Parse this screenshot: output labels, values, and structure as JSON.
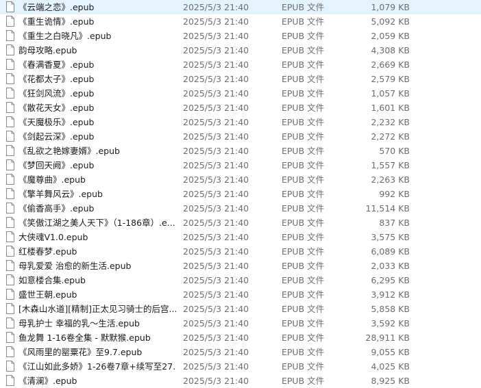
{
  "files": [
    {
      "name": "《云端之恋》.epub",
      "date": "2025/5/3 21:40",
      "type": "EPUB 文件",
      "size": "1,079 KB",
      "icon": "file-icon"
    },
    {
      "name": "《重生诡情》.epub",
      "date": "2025/5/3 21:40",
      "type": "EPUB 文件",
      "size": "5,092 KB",
      "icon": "file-icon"
    },
    {
      "name": "《重生之白晓凡》.epub",
      "date": "2025/5/3 21:40",
      "type": "EPUB 文件",
      "size": "2,059 KB",
      "icon": "file-icon"
    },
    {
      "name": "韵母攻略.epub",
      "date": "2025/5/3 21:40",
      "type": "EPUB 文件",
      "size": "4,308 KB",
      "icon": "file-icon"
    },
    {
      "name": "《春满香夏》.epub",
      "date": "2025/5/3 21:40",
      "type": "EPUB 文件",
      "size": "2,669 KB",
      "icon": "file-icon"
    },
    {
      "name": "《花都太子》.epub",
      "date": "2025/5/3 21:40",
      "type": "EPUB 文件",
      "size": "2,579 KB",
      "icon": "file-icon"
    },
    {
      "name": "《狂剑风流》.epub",
      "date": "2025/5/3 21:40",
      "type": "EPUB 文件",
      "size": "1,057 KB",
      "icon": "file-icon"
    },
    {
      "name": "《散花天女》.epub",
      "date": "2025/5/3 21:40",
      "type": "EPUB 文件",
      "size": "1,601 KB",
      "icon": "file-icon"
    },
    {
      "name": "《天魔极乐》.epub",
      "date": "2025/5/3 21:40",
      "type": "EPUB 文件",
      "size": "2,232 KB",
      "icon": "file-icon"
    },
    {
      "name": "《剑起云深》.epub",
      "date": "2025/5/3 21:40",
      "type": "EPUB 文件",
      "size": "2,272 KB",
      "icon": "file-icon"
    },
    {
      "name": "《乱欲之艳嫁妻婿》.epub",
      "date": "2025/5/3 21:40",
      "type": "EPUB 文件",
      "size": "570 KB",
      "icon": "file-icon"
    },
    {
      "name": "《梦回天阙》.epub",
      "date": "2025/5/3 21:40",
      "type": "EPUB 文件",
      "size": "1,557 KB",
      "icon": "file-icon"
    },
    {
      "name": "《魔尊曲》.epub",
      "date": "2025/5/3 21:40",
      "type": "EPUB 文件",
      "size": "2,263 KB",
      "icon": "file-icon"
    },
    {
      "name": "《擎羊舞风云》.epub",
      "date": "2025/5/3 21:40",
      "type": "EPUB 文件",
      "size": "992 KB",
      "icon": "file-icon"
    },
    {
      "name": "《偷香高手》.epub",
      "date": "2025/5/3 21:40",
      "type": "EPUB 文件",
      "size": "11,514 KB",
      "icon": "file-icon"
    },
    {
      "name": "《笑傲江湖之美人天下》（1-186章）.e...",
      "date": "2025/5/3 21:40",
      "type": "EPUB 文件",
      "size": "837 KB",
      "icon": "file-icon"
    },
    {
      "name": "大侠魂V1.0.epub",
      "date": "2025/5/3 21:40",
      "type": "EPUB 文件",
      "size": "3,575 KB",
      "icon": "file-icon"
    },
    {
      "name": "红楼春梦.epub",
      "date": "2025/5/3 21:40",
      "type": "EPUB 文件",
      "size": "6,089 KB",
      "icon": "file-icon"
    },
    {
      "name": "母乳爱爱 治愈的新生活.epub",
      "date": "2025/5/3 21:40",
      "type": "EPUB 文件",
      "size": "2,033 KB",
      "icon": "file-icon"
    },
    {
      "name": "如意楼合集.epub",
      "date": "2025/5/3 21:40",
      "type": "EPUB 文件",
      "size": "6,295 KB",
      "icon": "file-icon"
    },
    {
      "name": "盛世王朝.epub",
      "date": "2025/5/3 21:40",
      "type": "EPUB 文件",
      "size": "3,912 KB",
      "icon": "file-icon"
    },
    {
      "name": "[木森山水道][精制]正太见习骑士的后宫...",
      "date": "2025/5/3 21:40",
      "type": "EPUB 文件",
      "size": "5,858 KB",
      "icon": "file-icon"
    },
    {
      "name": "母乳护士 幸福的乳～生活.epub",
      "date": "2025/5/3 21:40",
      "type": "EPUB 文件",
      "size": "3,592 KB",
      "icon": "file-icon"
    },
    {
      "name": "鱼龙舞 1-16卷全集 - 默默猴.epub",
      "date": "2025/5/3 21:40",
      "type": "EPUB 文件",
      "size": "28,911 KB",
      "icon": "file-icon"
    },
    {
      "name": "《风雨里的罂粟花》至9.7.epub",
      "date": "2025/5/3 21:40",
      "type": "EPUB 文件",
      "size": "9,055 KB",
      "icon": "file-icon"
    },
    {
      "name": "《江山如此多娇》1-26卷7章+续写至27...",
      "date": "2025/5/3 21:40",
      "type": "EPUB 文件",
      "size": "4,025 KB",
      "icon": "file-icon"
    },
    {
      "name": "《清澜》.epub",
      "date": "2025/5/3 21:40",
      "type": "EPUB 文件",
      "size": "8,925 KB",
      "icon": "file-icon"
    }
  ]
}
